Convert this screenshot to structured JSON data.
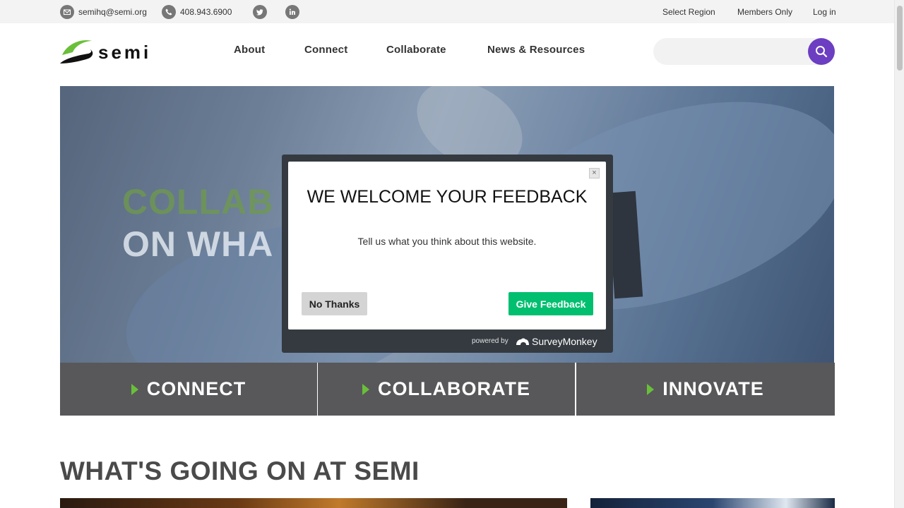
{
  "topbar": {
    "email": "semihq@semi.org",
    "phone": "408.943.6900",
    "select_region": "Select Region",
    "members_only": "Members Only",
    "log_in": "Log in",
    "icons": [
      "envelope-icon",
      "phone-icon",
      "twitter-icon",
      "linkedin-icon"
    ]
  },
  "header": {
    "logo_text": "semi",
    "nav": [
      "About",
      "Connect",
      "Collaborate",
      "News & Resources"
    ],
    "search": {
      "placeholder": "",
      "value": ""
    }
  },
  "hero": {
    "line1": "COLLAB",
    "line2": "ON WHA"
  },
  "cta": [
    {
      "label": "CONNECT"
    },
    {
      "label": "COLLABORATE"
    },
    {
      "label": "INNOVATE"
    }
  ],
  "section": {
    "title": "WHAT'S GOING ON AT SEMI"
  },
  "modal": {
    "title": "WE WELCOME YOUR FEEDBACK",
    "subtitle": "Tell us what you think about this website.",
    "close_glyph": "×",
    "no_thanks": "No Thanks",
    "give_feedback": "Give Feedback",
    "powered_by": "powered by",
    "brand": "SurveyMonkey"
  },
  "colors": {
    "accent_purple": "#6c3ec1",
    "brand_green": "#6abf3a",
    "feedback_green": "#00bf6f",
    "cta_gray": "#58585a"
  }
}
